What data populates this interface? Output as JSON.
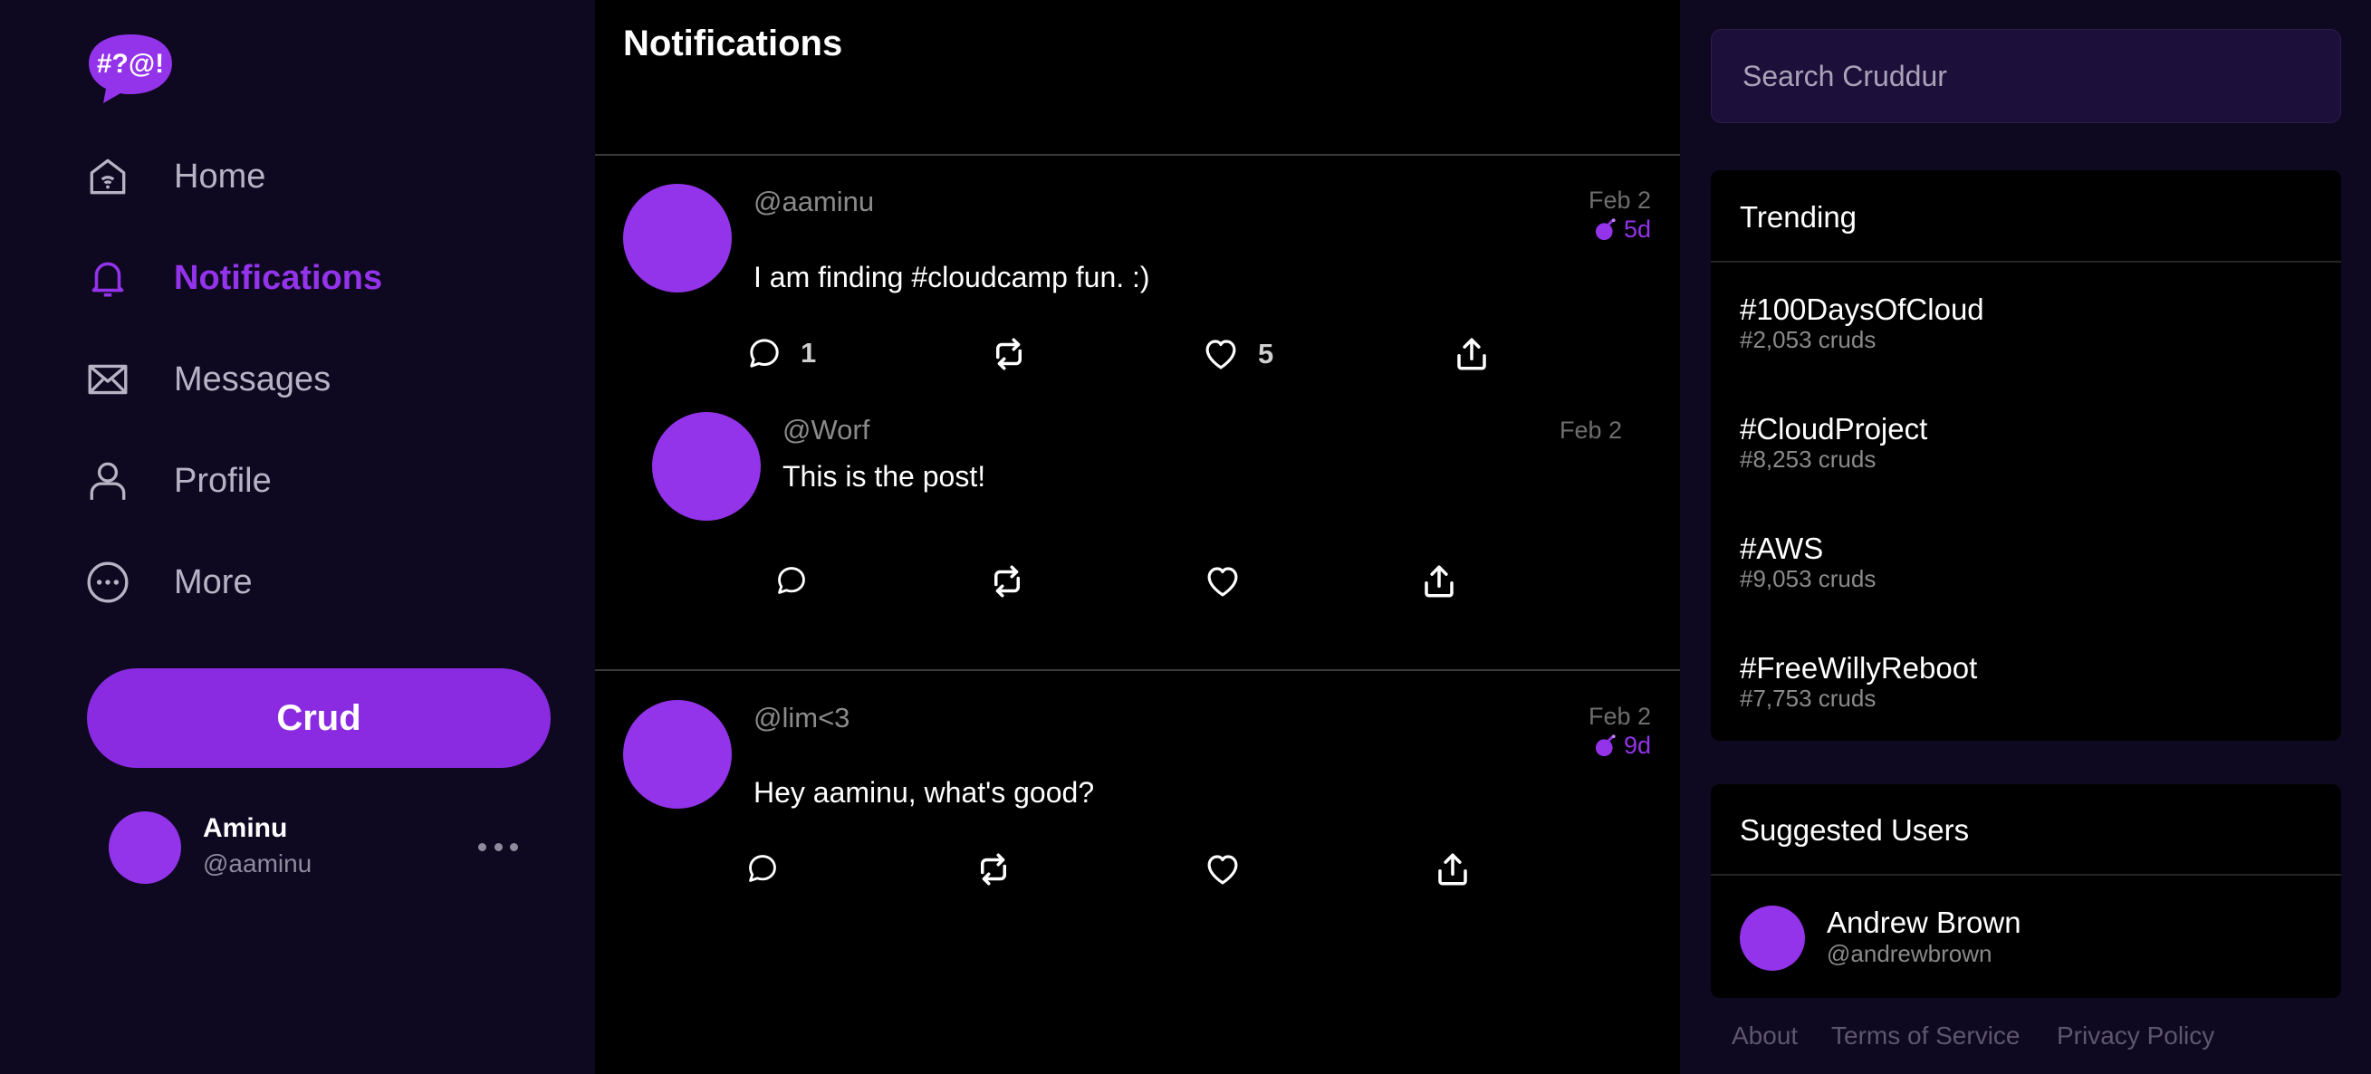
{
  "sidebar": {
    "logo_text": "#?@!",
    "items": [
      {
        "label": "Home",
        "icon": "home-icon"
      },
      {
        "label": "Notifications",
        "icon": "bell-icon",
        "active": true
      },
      {
        "label": "Messages",
        "icon": "envelope-icon"
      },
      {
        "label": "Profile",
        "icon": "user-icon"
      },
      {
        "label": "More",
        "icon": "more-circle-icon"
      }
    ],
    "crud_label": "Crud",
    "profile": {
      "name": "Aminu",
      "handle": "@aaminu"
    }
  },
  "main": {
    "title": "Notifications",
    "posts": [
      {
        "handle": "@aaminu",
        "date": "Feb 2",
        "ttl": "5d",
        "message": "I am finding #cloudcamp fun. :)",
        "replies": "1",
        "likes": "5"
      },
      {
        "handle": "@Worf",
        "date": "Feb 2",
        "message": "This is the post!"
      },
      {
        "handle": "@lim<3",
        "date": "Feb 2",
        "ttl": "9d",
        "message": "Hey aaminu, what's good?"
      }
    ]
  },
  "right": {
    "search_placeholder": "Search Cruddur",
    "trending": {
      "title": "Trending",
      "items": [
        {
          "tag": "#100DaysOfCloud",
          "count": "#2,053 cruds"
        },
        {
          "tag": "#CloudProject",
          "count": "#8,253 cruds"
        },
        {
          "tag": "#AWS",
          "count": "#9,053 cruds"
        },
        {
          "tag": "#FreeWillyReboot",
          "count": "#7,753 cruds"
        }
      ]
    },
    "suggested": {
      "title": "Suggested Users",
      "users": [
        {
          "name": "Andrew Brown",
          "handle": "@andrewbrown"
        }
      ]
    },
    "footer": [
      "About",
      "Terms of Service",
      "Privacy Policy"
    ]
  },
  "colors": {
    "accent": "#9333ea",
    "sidebar_bg": "#0e0821",
    "feed_bg": "#000000"
  }
}
